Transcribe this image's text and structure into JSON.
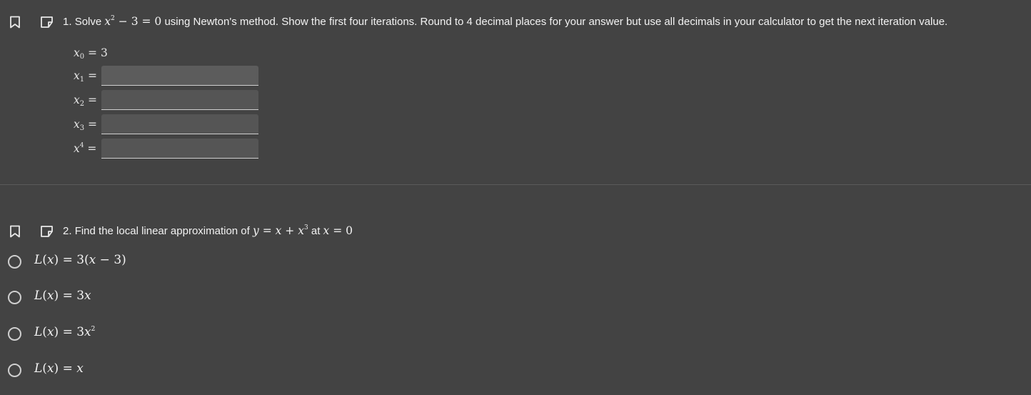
{
  "question1": {
    "number": "1.",
    "text_before": "Solve",
    "equation_var": "x",
    "equation_exp": "2",
    "equation_rest": " − 3 = 0",
    "text_after": "using Newton's method. Show the first four iterations. Round to 4 decimal places for your answer but use all decimals in your calculator to get the next iteration value.",
    "x0": {
      "var": "x",
      "sub": "0",
      "eq": " = 3"
    },
    "rows": [
      {
        "var": "x",
        "sub": "1",
        "sup": "",
        "eq": " =",
        "value": ""
      },
      {
        "var": "x",
        "sub": "2",
        "sup": "",
        "eq": " =",
        "value": ""
      },
      {
        "var": "x",
        "sub": "3",
        "sup": "",
        "eq": " =",
        "value": ""
      },
      {
        "var": "x",
        "sub": "",
        "sup": "4",
        "eq": " =",
        "value": ""
      }
    ]
  },
  "question2": {
    "number": "2.",
    "text_before": "Find the local linear approximation of",
    "func_y": "y",
    "func_eq": " = ",
    "func_x": "x",
    "func_plus": " + ",
    "func_x2": "x",
    "func_exp": "3",
    "text_at": "at",
    "at_var": "x",
    "at_eq": " = 0",
    "options": [
      {
        "L": "L",
        "open": "(",
        "x": "x",
        "close": ")",
        "eq": " = 3(",
        "tail_var": "x",
        "tail": " − 3)",
        "exp": ""
      },
      {
        "L": "L",
        "open": "(",
        "x": "x",
        "close": ")",
        "eq": " = 3",
        "tail_var": "x",
        "tail": "",
        "exp": ""
      },
      {
        "L": "L",
        "open": "(",
        "x": "x",
        "close": ")",
        "eq": " = 3",
        "tail_var": "x",
        "tail": "",
        "exp": "2"
      },
      {
        "L": "L",
        "open": "(",
        "x": "x",
        "close": ")",
        "eq": " = ",
        "tail_var": "x",
        "tail": "",
        "exp": ""
      }
    ]
  },
  "colors": {
    "background": "#434343",
    "text": "#f2f2f2",
    "input_bg": "#555555",
    "border": "#cfcfcf"
  },
  "icons": {
    "bookmark": "bookmark-icon",
    "note": "note-icon",
    "radio": "radio-unselected-icon"
  }
}
